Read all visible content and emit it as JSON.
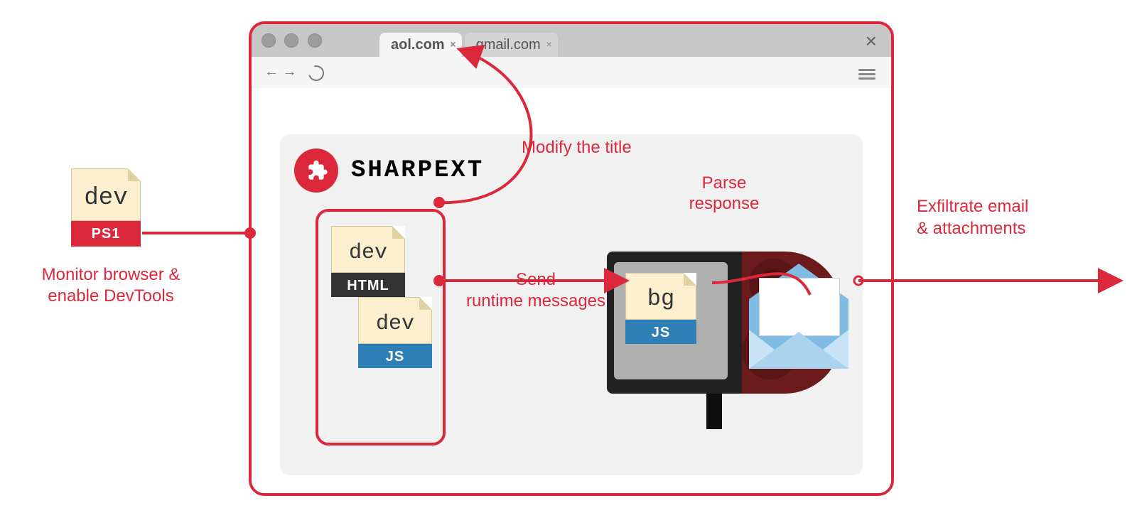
{
  "left_file": {
    "label": "dev",
    "band": "PS1"
  },
  "monitor_label_1": "Monitor browser &",
  "monitor_label_2": "enable DevTools",
  "browser": {
    "tab_active": "aol.com",
    "tab_inactive": "gmail.com"
  },
  "extension_name": "SHARPEXT",
  "dev_html": {
    "label": "dev",
    "band": "HTML"
  },
  "dev_js": {
    "label": "dev",
    "band": "JS"
  },
  "bg_file": {
    "label": "bg",
    "band": "JS"
  },
  "modify_title": "Modify the title",
  "send_rtm_1": "Send",
  "send_rtm_2": "runtime messages",
  "parse_resp_1": "Parse",
  "parse_resp_2": "response",
  "exfil_1": "Exfiltrate email",
  "exfil_2": "& attachments"
}
